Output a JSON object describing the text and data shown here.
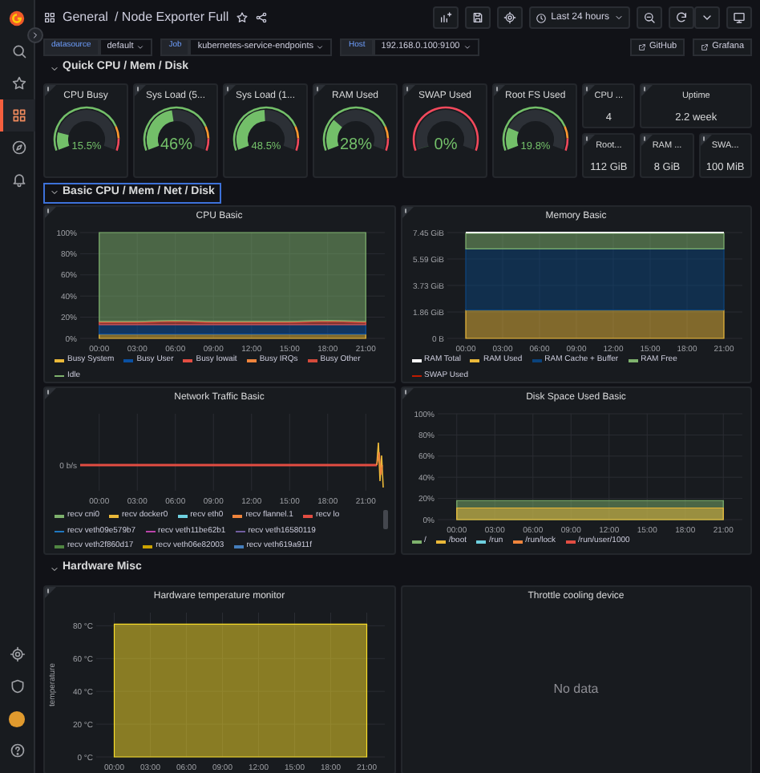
{
  "sidebar": {
    "items": [
      {
        "selected": false
      },
      {
        "selected": false
      },
      {
        "selected": true
      },
      {
        "selected": false
      },
      {
        "selected": false
      }
    ]
  },
  "toolbar": {
    "folder": "General",
    "title": "/ Node Exporter Full",
    "starred": false,
    "time_range": "Last 24 hours"
  },
  "variables": [
    {
      "label": "datasource",
      "value": "default"
    },
    {
      "label": "Job",
      "value": "kubernetes-service-endpoints"
    },
    {
      "label": "Host",
      "value": "192.168.0.100:9100"
    }
  ],
  "links": [
    {
      "label": "GitHub"
    },
    {
      "label": "Grafana"
    }
  ],
  "rows": [
    {
      "title": "Quick CPU / Mem / Disk",
      "expanded": true,
      "selected": false,
      "gauges": [
        {
          "title": "CPU Busy",
          "value": "15.5%",
          "level": 0.155,
          "kind": "green_red"
        },
        {
          "title": "Sys Load (5...",
          "value": "46%",
          "level": 0.46,
          "kind": "green_red"
        },
        {
          "title": "Sys Load (1...",
          "value": "48.5%",
          "level": 0.485,
          "kind": "green_red"
        },
        {
          "title": "RAM Used",
          "value": "28%",
          "level": 0.28,
          "kind": "green_red"
        },
        {
          "title": "SWAP Used",
          "value": "0%",
          "level": 0,
          "kind": "red"
        },
        {
          "title": "Root FS Used",
          "value": "19.8%",
          "level": 0.198,
          "kind": "green_red"
        }
      ],
      "stats": [
        {
          "title": "CPU ...",
          "value": "4"
        },
        {
          "title": "Uptime",
          "value": "2.2 week"
        },
        {
          "title": "Root...",
          "value": "112 GiB"
        },
        {
          "title": "RAM ...",
          "value": "8 GiB"
        },
        {
          "title": "SWA...",
          "value": "100 MiB"
        }
      ]
    },
    {
      "title": "Basic CPU / Mem / Net / Disk",
      "expanded": true,
      "selected": true,
      "panels": [
        {
          "kind": "chart",
          "chart_data": {
            "type": "area",
            "title": "CPU Basic",
            "x": [
              "00:00",
              "03:00",
              "06:00",
              "09:00",
              "12:00",
              "15:00",
              "18:00",
              "21:00"
            ],
            "ylim": [
              0,
              100
            ],
            "yticks": [
              {
                "value": 0,
                "label": "0%"
              },
              {
                "value": 20,
                "label": "20%"
              },
              {
                "value": 40,
                "label": "40%"
              },
              {
                "value": 60,
                "label": "60%"
              },
              {
                "value": 80,
                "label": "80%"
              },
              {
                "value": 100,
                "label": "100%"
              }
            ],
            "stacked": true,
            "grid": true,
            "series": [
              {
                "name": "Busy System",
                "color": "#eab839",
                "values": [
                  4,
                  4,
                  4,
                  4,
                  4,
                  4,
                  4,
                  4
                ]
              },
              {
                "name": "Busy User",
                "color": "#0a50a1",
                "values": [
                  9,
                  9,
                  9,
                  9,
                  9,
                  9,
                  9,
                  9
                ]
              },
              {
                "name": "Busy Iowait",
                "color": "#e24d42",
                "values": [
                  2,
                  2,
                  3,
                  2,
                  2,
                  2,
                  3,
                  2
                ]
              },
              {
                "name": "Busy IRQs",
                "color": "#ef843c",
                "values": [
                  null,
                  null,
                  null,
                  null,
                  null,
                  null,
                  null,
                  null
                ]
              },
              {
                "name": "Busy Other",
                "color": "#d44a3a",
                "values": [
                  1,
                  1,
                  1,
                  1,
                  1,
                  1,
                  1,
                  1
                ]
              },
              {
                "name": "Idle",
                "color": "#7eb26d",
                "values": [
                  84,
                  84,
                  83,
                  84,
                  84,
                  84,
                  83,
                  84
                ]
              }
            ]
          }
        },
        {
          "kind": "chart",
          "chart_data": {
            "type": "area",
            "title": "Memory Basic",
            "x": [
              "00:00",
              "03:00",
              "06:00",
              "09:00",
              "12:00",
              "15:00",
              "18:00",
              "21:00"
            ],
            "ylim": [
              0,
              7.45
            ],
            "yticks": [
              {
                "value": 0,
                "label": "0 B"
              },
              {
                "value": 1.86,
                "label": "1.86 GiB"
              },
              {
                "value": 3.73,
                "label": "3.73 GiB"
              },
              {
                "value": 5.59,
                "label": "5.59 GiB"
              },
              {
                "value": 7.45,
                "label": "7.45 GiB"
              }
            ],
            "stacked": true,
            "grid": true,
            "ref_lines": [
              {
                "axis": "y",
                "value": 7.45,
                "label": "RAM Total",
                "color": "#ffffff"
              }
            ],
            "series": [
              {
                "name": "RAM Used",
                "color": "#eab839",
                "values": [
                  2.0,
                  2.0,
                  2.0,
                  2.0,
                  2.0,
                  2.0,
                  2.0,
                  2.0
                ]
              },
              {
                "name": "RAM Cache + Buffer",
                "color": "#0a437c",
                "values": [
                  4.3,
                  4.3,
                  4.3,
                  4.3,
                  4.3,
                  4.3,
                  4.3,
                  4.3
                ]
              },
              {
                "name": "RAM Free",
                "color": "#7eb26d",
                "values": [
                  1.1,
                  1.1,
                  1.1,
                  1.1,
                  1.1,
                  1.1,
                  1.1,
                  1.1
                ]
              },
              {
                "name": "SWAP Used",
                "color": "#bf1b00",
                "values": [
                  null,
                  null,
                  null,
                  null,
                  null,
                  null,
                  null,
                  null
                ]
              }
            ]
          }
        },
        {
          "kind": "traffic",
          "title": "Network Traffic Basic",
          "y_label": "0 b/s",
          "x_labels": [
            "00:00",
            "03:00",
            "06:00",
            "09:00",
            "12:00",
            "15:00",
            "18:00",
            "21:00"
          ],
          "legend": [
            {
              "label": "recv cni0",
              "color": "#7eb26d"
            },
            {
              "label": "recv docker0",
              "color": "#eab839"
            },
            {
              "label": "recv eth0",
              "color": "#6ed0e0"
            },
            {
              "label": "recv flannel.1",
              "color": "#ef843c"
            },
            {
              "label": "recv lo",
              "color": "#e24d42"
            },
            {
              "label": "recv veth09e579b7",
              "color": "#1f78c1"
            },
            {
              "label": "recv veth11be62b1",
              "color": "#ba43a9"
            },
            {
              "label": "recv veth16580119",
              "color": "#705da0"
            },
            {
              "label": "recv veth2f860d17",
              "color": "#508642"
            },
            {
              "label": "recv veth06e82003",
              "color": "#cca300"
            },
            {
              "label": "recv veth619a911f",
              "color": "#447ebc"
            }
          ]
        },
        {
          "kind": "chart",
          "chart_data": {
            "type": "area",
            "title": "Disk Space Used Basic",
            "x": [
              "00:00",
              "03:00",
              "06:00",
              "09:00",
              "12:00",
              "15:00",
              "18:00",
              "21:00"
            ],
            "ylim": [
              0,
              100
            ],
            "yticks": [
              {
                "value": 0,
                "label": "0%"
              },
              {
                "value": 20,
                "label": "20%"
              },
              {
                "value": 40,
                "label": "40%"
              },
              {
                "value": 60,
                "label": "60%"
              },
              {
                "value": 80,
                "label": "80%"
              },
              {
                "value": 100,
                "label": "100%"
              }
            ],
            "stacked": false,
            "grid": true,
            "series": [
              {
                "name": "/",
                "color": "#7eb26d",
                "values": [
                  18,
                  18,
                  18,
                  18,
                  18,
                  18,
                  18,
                  18
                ]
              },
              {
                "name": "/boot",
                "color": "#eab839",
                "values": [
                  11,
                  11,
                  11,
                  11,
                  11,
                  11,
                  11,
                  11
                ]
              },
              {
                "name": "/run",
                "color": "#6ed0e0",
                "values": [
                  null,
                  null,
                  null,
                  null,
                  null,
                  null,
                  null,
                  null
                ]
              },
              {
                "name": "/run/lock",
                "color": "#ef843c",
                "values": [
                  null,
                  null,
                  null,
                  null,
                  null,
                  null,
                  null,
                  null
                ]
              },
              {
                "name": "/run/user/1000",
                "color": "#e24d42",
                "values": [
                  null,
                  null,
                  null,
                  null,
                  null,
                  null,
                  null,
                  null
                ]
              }
            ]
          }
        }
      ]
    },
    {
      "title": "Hardware Misc",
      "expanded": true,
      "selected": false,
      "panels": [
        {
          "kind": "chart",
          "chart_data": {
            "type": "area",
            "title": "Hardware temperature monitor",
            "ylabel": "temperature",
            "x": [
              "00:00",
              "03:00",
              "06:00",
              "09:00",
              "12:00",
              "15:00",
              "18:00",
              "21:00"
            ],
            "ylim": [
              0,
              88
            ],
            "yticks": [
              {
                "value": 0,
                "label": "0 °C"
              },
              {
                "value": 20,
                "label": "20 °C"
              },
              {
                "value": 40,
                "label": "40 °C"
              },
              {
                "value": 60,
                "label": "60 °C"
              },
              {
                "value": 80,
                "label": "80 °C"
              }
            ],
            "stacked": false,
            "grid": true,
            "series": [
              {
                "color": "#fade2a",
                "values": [
                  81,
                  81,
                  81,
                  81,
                  81,
                  81,
                  81,
                  81
                ]
              }
            ]
          }
        },
        {
          "kind": "empty",
          "title": "Throttle cooling device",
          "message": "No data"
        }
      ]
    }
  ]
}
